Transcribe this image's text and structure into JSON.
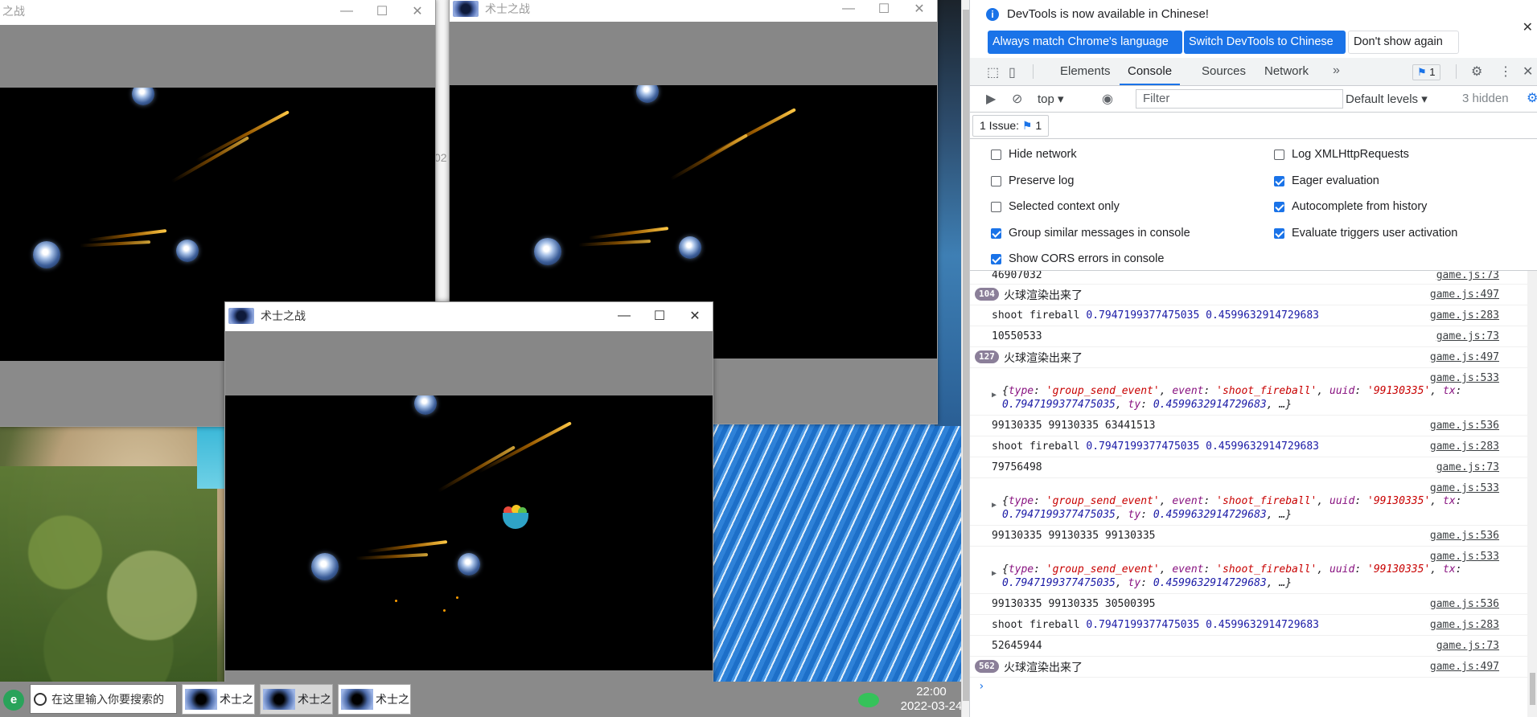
{
  "game_windows": {
    "title": "术士之战",
    "title_partial": "之战",
    "minimize": "—",
    "maximize": "☐",
    "close": "✕",
    "fragment_02": "02"
  },
  "taskbar": {
    "search_placeholder": "在这里输入你要搜索的",
    "tasks": [
      "术士之战",
      "术士之战",
      "术士之战"
    ],
    "time": "22:00",
    "date": "2022-03-24"
  },
  "devtools": {
    "infobar": {
      "message": "DevTools is now available in Chinese!",
      "btn_match": "Always match Chrome's language",
      "btn_switch": "Switch DevTools to Chinese",
      "btn_dismiss": "Don't show again"
    },
    "tabs": [
      "Elements",
      "Console",
      "Sources",
      "Network"
    ],
    "active_tab": "Console",
    "issues_badge": "1",
    "toolbar": {
      "context": "top",
      "filter_placeholder": "Filter",
      "levels": "Default levels",
      "hidden": "3 hidden"
    },
    "issues_row": {
      "label": "1 Issue:",
      "count": "1"
    },
    "settings": {
      "hide_network": "Hide network",
      "preserve_log": "Preserve log",
      "selected_context": "Selected context only",
      "group_similar": "Group similar messages in console",
      "show_cors": "Show CORS errors in console",
      "log_xhr": "Log XMLHttpRequests",
      "eager_eval": "Eager evaluation",
      "autocomplete": "Autocomplete from history",
      "evaluate_triggers": "Evaluate triggers user activation"
    },
    "console": {
      "l1": {
        "msg": "46907032",
        "src": "game.js:73"
      },
      "l2": {
        "count": "104",
        "msg": "火球渲染出来了",
        "src": "game.js:497"
      },
      "l3": {
        "text": "shoot fireball ",
        "a": "0.7947199377475035",
        "b": "0.4599632914729683",
        "src": "game.js:283"
      },
      "l4": {
        "msg": "10550533",
        "src": "game.js:73"
      },
      "l5": {
        "count": "127",
        "msg": "火球渲染出来了",
        "src": "game.js:497"
      },
      "obj_src": "game.js:533",
      "obj": {
        "type_key": "type",
        "type_val": "'group_send_event'",
        "event_key": "event",
        "event_val": "'shoot_fireball'",
        "uuid_key": "uuid",
        "uuid_val": "'99130335'",
        "tx_key": "tx",
        "tx_val": "0.7947199377475035",
        "ty_key": "ty",
        "ty_val": "0.4599632914729683",
        "ellipsis": "…}"
      },
      "l7": {
        "msg": "99130335 99130335 63441513",
        "src": "game.js:536"
      },
      "l8": {
        "text": "shoot fireball ",
        "a": "0.7947199377475035",
        "b": "0.4599632914729683",
        "src": "game.js:283"
      },
      "l9": {
        "msg": "79756498",
        "src": "game.js:73"
      },
      "l11": {
        "msg": "99130335 99130335 99130335",
        "src": "game.js:536"
      },
      "l13": {
        "msg": "99130335 99130335 30500395",
        "src": "game.js:536"
      },
      "l14": {
        "text": "shoot fireball ",
        "a": "0.7947199377475035",
        "b": "0.4599632914729683",
        "src": "game.js:283"
      },
      "l15": {
        "msg": "52645944",
        "src": "game.js:73"
      },
      "l16": {
        "count": "562",
        "msg": "火球渲染出来了",
        "src": "game.js:497"
      },
      "prompt": "›"
    }
  }
}
